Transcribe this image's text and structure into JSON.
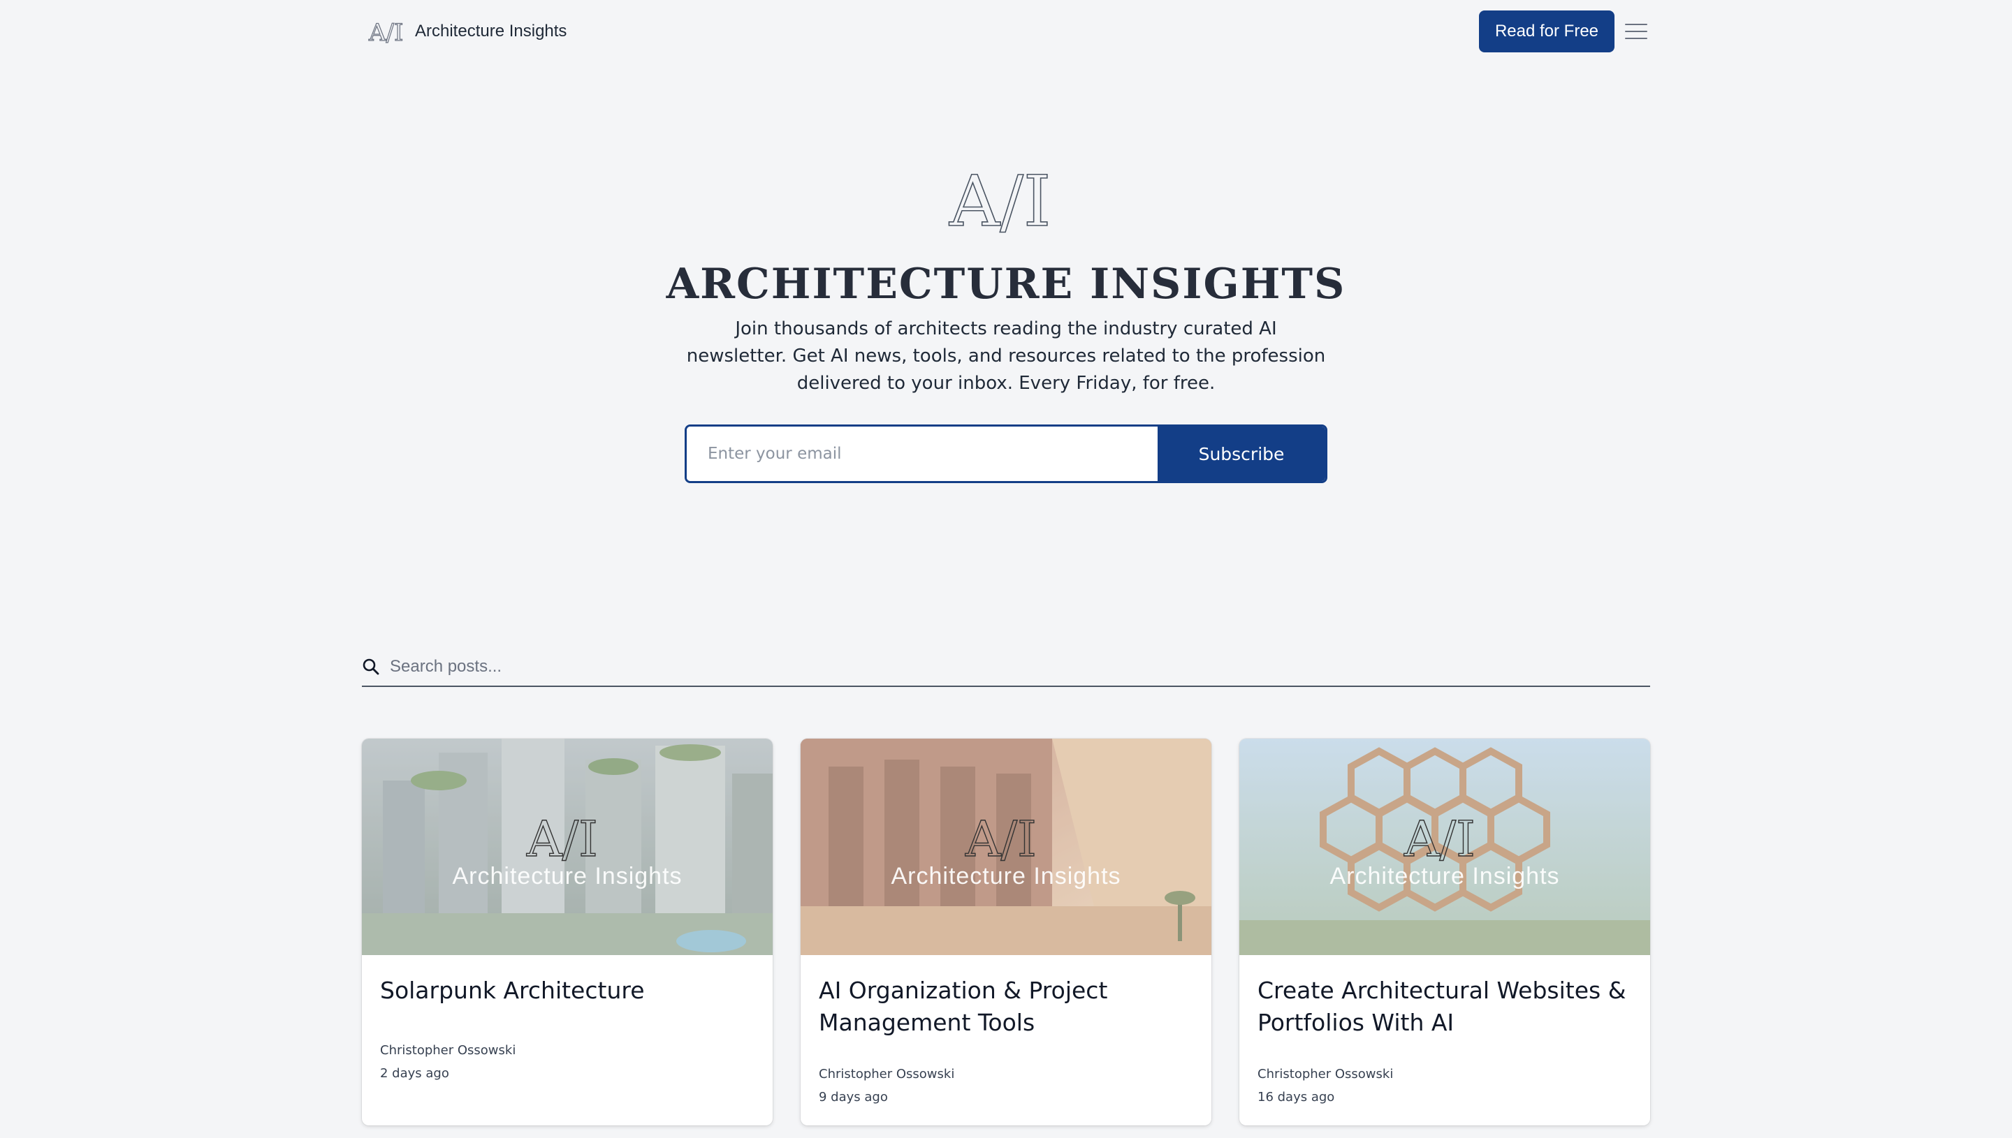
{
  "nav": {
    "brand": "Architecture Insights",
    "logo_text": "A/I",
    "cta_label": "Read for Free",
    "menu_icon": "hamburger-icon"
  },
  "hero": {
    "logo_text": "A/I",
    "title": "ARCHITECTURE INSIGHTS",
    "subtitle": "Join thousands of architects reading the industry curated AI newsletter. Get AI news, tools, and resources related to the profession delivered to your inbox. Every Friday, for free.",
    "email_placeholder": "Enter your email",
    "subscribe_label": "Subscribe"
  },
  "search": {
    "placeholder": "Search posts...",
    "icon": "search-icon"
  },
  "posts": [
    {
      "title": "Solarpunk Architecture",
      "author": "Christopher Ossowski",
      "date": "2 days ago",
      "thumb_logo": "A/I",
      "thumb_text": "Architecture Insights"
    },
    {
      "title": "AI Organization & Project Management Tools",
      "author": "Christopher Ossowski",
      "date": "9 days ago",
      "thumb_logo": "A/I",
      "thumb_text": "Architecture Insights"
    },
    {
      "title": "Create Architectural Websites & Portfolios With AI",
      "author": "Christopher Ossowski",
      "date": "16 days ago",
      "thumb_logo": "A/I",
      "thumb_text": "Architecture Insights"
    }
  ],
  "colors": {
    "accent": "#133e87",
    "background": "#f4f5f7",
    "heading": "#272d3a"
  }
}
